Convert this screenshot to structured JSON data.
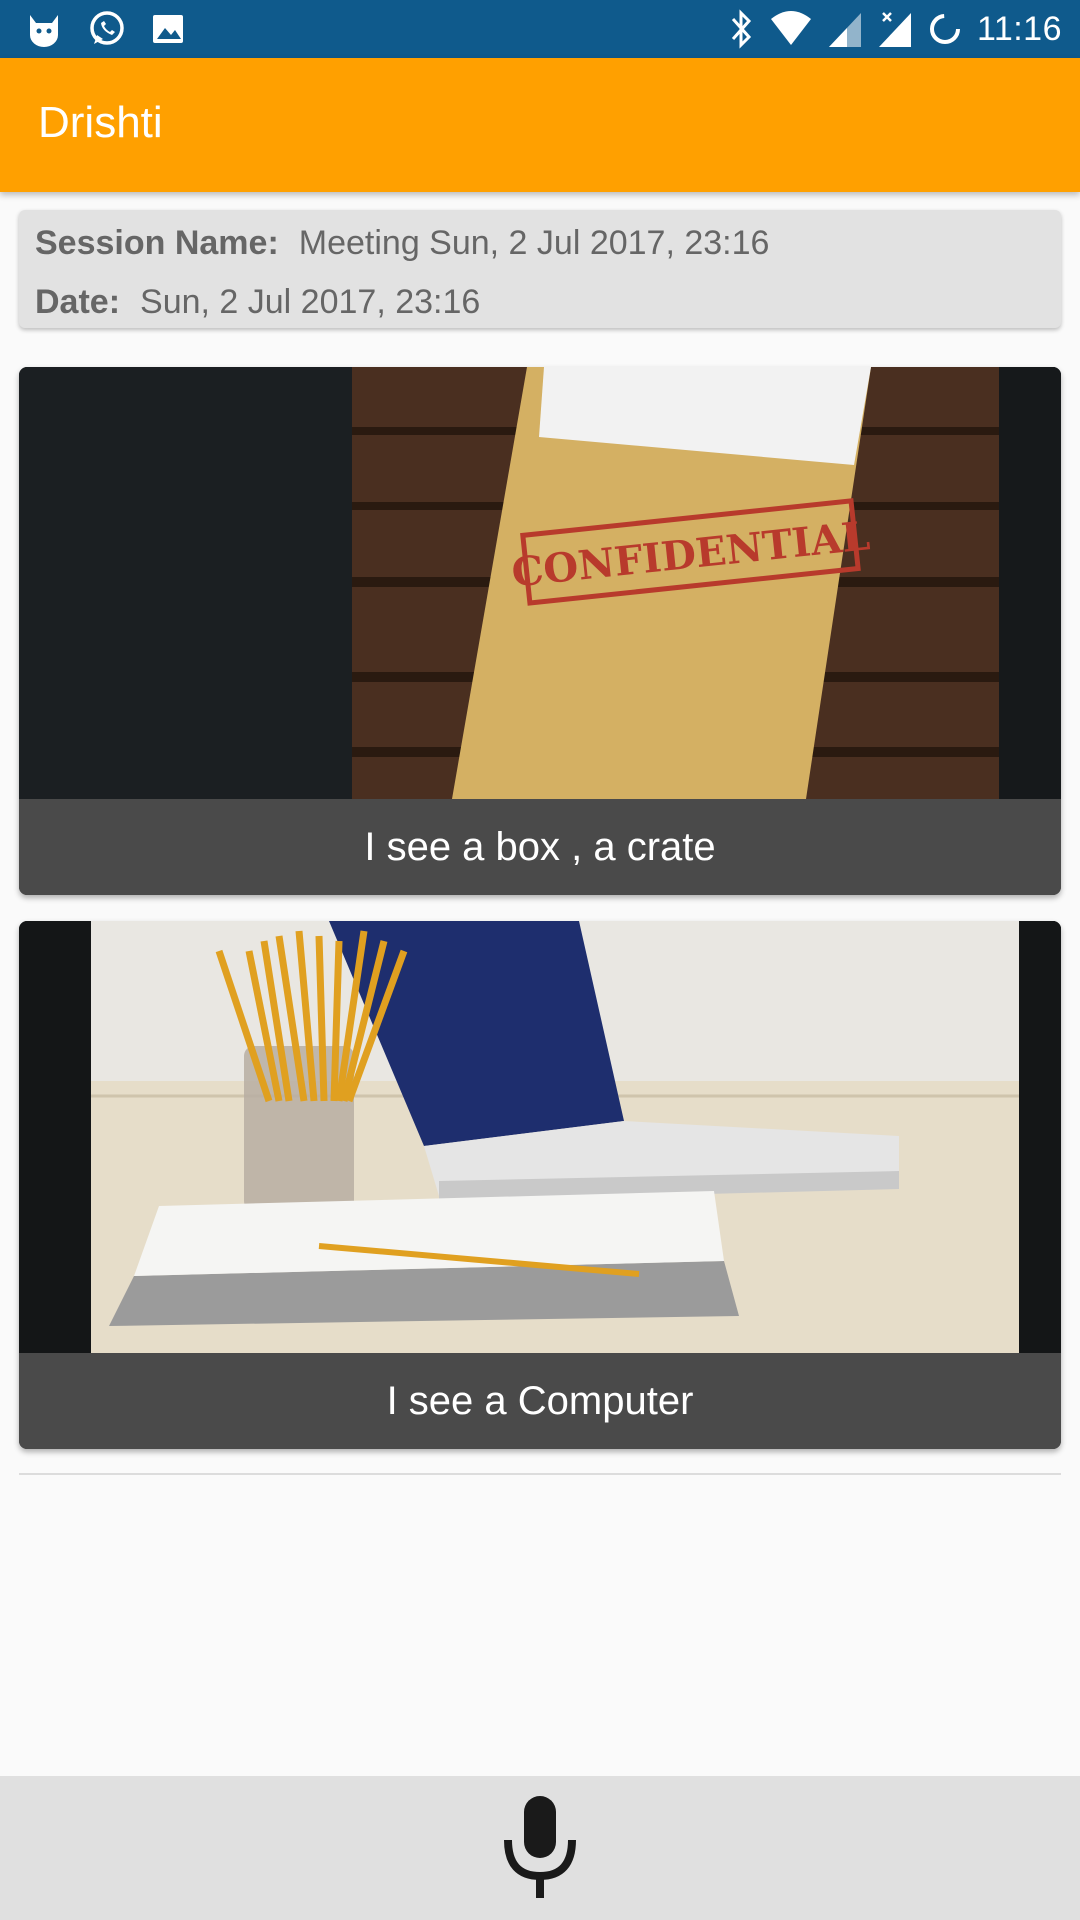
{
  "status_bar": {
    "time": "11:16",
    "left_icons": [
      "cat-app-icon",
      "whatsapp-icon",
      "gallery-icon"
    ],
    "right_icons": [
      "bluetooth-icon",
      "wifi-icon",
      "signal-icon",
      "signal-x-icon",
      "sync-icon"
    ]
  },
  "app_bar": {
    "title": "Drishti",
    "color": "#ffa000"
  },
  "session": {
    "name_label": "Session Name:",
    "name_value": "Meeting Sun, 2 Jul 2017, 23:16",
    "date_label": "Date:",
    "date_value": "Sun, 2 Jul 2017, 23:16"
  },
  "cards": [
    {
      "caption": "I see a box , a crate",
      "stamp_text": "CONFIDENTIAL"
    },
    {
      "caption": "I see a Computer"
    }
  ],
  "bottom_bar": {
    "icon": "microphone-icon"
  }
}
